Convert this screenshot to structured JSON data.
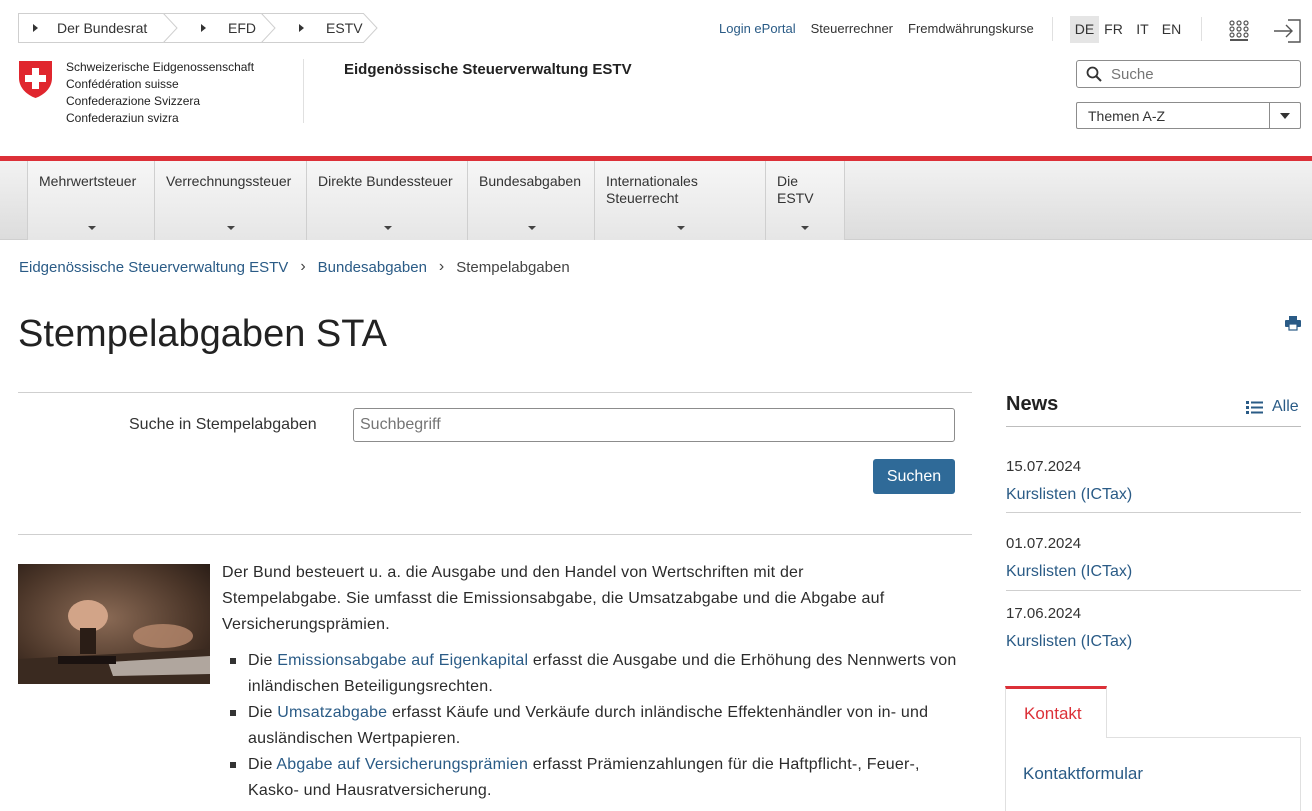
{
  "top_breadcrumb": [
    "Der Bundesrat",
    "EFD",
    "ESTV"
  ],
  "top_links": [
    "Login ePortal",
    "Steuerrechner",
    "Fremdwährungskurse"
  ],
  "languages": [
    "DE",
    "FR",
    "IT",
    "EN"
  ],
  "active_language": "DE",
  "logo_lines": [
    "Schweizerische Eidgenossenschaft",
    "Confédération suisse",
    "Confederazione Svizzera",
    "Confederaziun svizra"
  ],
  "agency_name": "Eidgenössische Steuerverwaltung ESTV",
  "header_search_placeholder": "Suche",
  "themen_select": "Themen A-Z",
  "main_nav": [
    "Mehrwertsteuer",
    "Verrechnungssteuer",
    "Direkte Bundessteuer",
    "Bundesabgaben",
    "Internationales Steuerrecht",
    "Die ESTV"
  ],
  "breadcrumb": [
    "Eidgenössische Steuerverwaltung ESTV",
    "Bundesabgaben",
    "Stempelabgaben"
  ],
  "page_title": "Stempelabgaben STA",
  "local_search": {
    "label": "Suche in Stempelabgaben",
    "placeholder": "Suchbegriff",
    "button": "Suchen"
  },
  "intro": "Der Bund besteuert u. a. die Ausgabe und den Handel von Wertschriften mit der Stempelabgabe. Sie umfasst die Emissionsabgabe, die Umsatzabgabe und die Abgabe auf Versicherungsprämien.",
  "bullets": [
    {
      "pre": "Die ",
      "link": "Emissionsabgabe auf Eigenkapital",
      "post": " erfasst die Ausgabe und die Erhöhung des Nennwerts von inländischen Beteiligungsrechten."
    },
    {
      "pre": "Die ",
      "link": "Umsatzabgabe",
      "post": " erfasst Käufe und Verkäufe durch inländische Effektenhändler von in- und ausländischen Wertpapieren."
    },
    {
      "pre": "Die ",
      "link": "Abgabe auf Versicherungsprämien",
      "post": " erfasst Prämienzahlungen für die Haftpflicht-, Feuer-, Kasko- und Hausratversicherung."
    }
  ],
  "news": {
    "heading": "News",
    "all_label": "Alle",
    "items": [
      {
        "date": "15.07.2024",
        "link": "Kurslisten (ICTax)"
      },
      {
        "date": "01.07.2024",
        "link": "Kurslisten (ICTax)"
      },
      {
        "date": "17.06.2024",
        "link": "Kurslisten (ICTax)"
      }
    ]
  },
  "contact": {
    "tab": "Kontakt",
    "link": "Kontaktformular"
  },
  "colors": {
    "accent_red": "#dc3038",
    "link_blue": "#2a5b86",
    "button_blue": "#2f6a98"
  }
}
